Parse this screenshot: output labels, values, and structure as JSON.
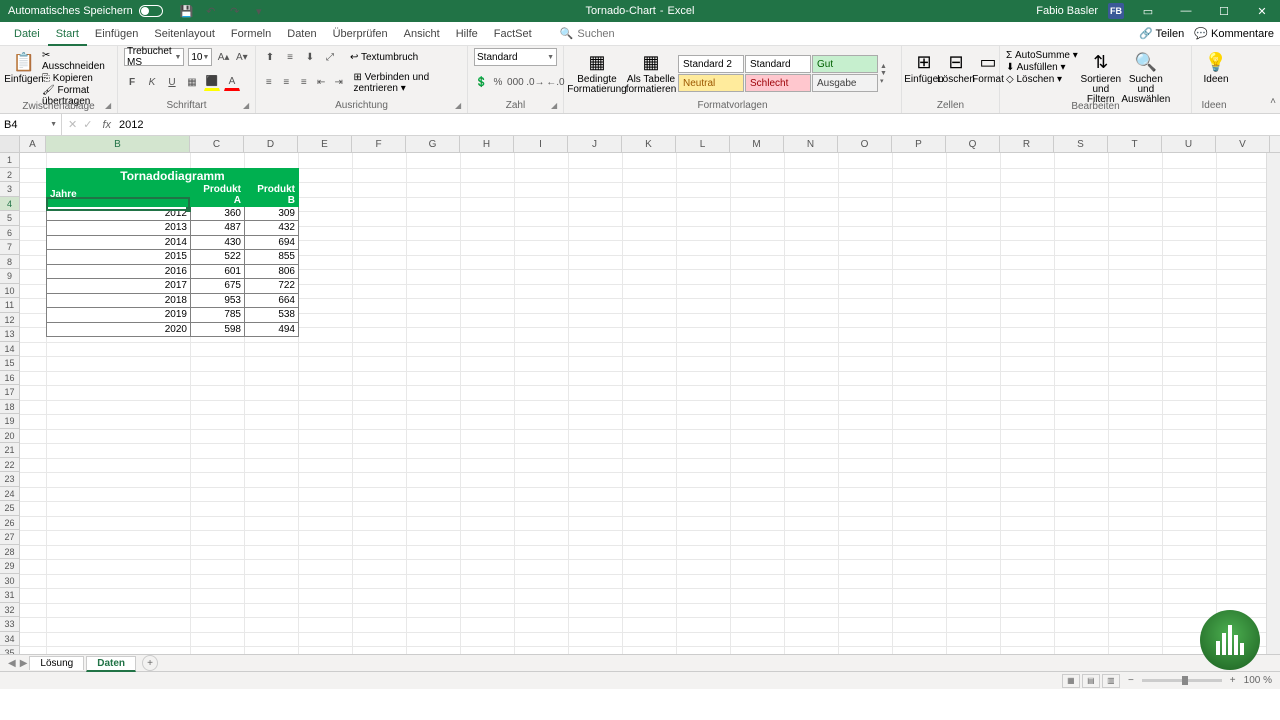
{
  "titlebar": {
    "autosave_label": "Automatisches Speichern",
    "doc_name": "Tornado-Chart",
    "app_name": "Excel",
    "user_name": "Fabio Basler",
    "user_initials": "FB"
  },
  "tabs": {
    "file": "Datei",
    "items": [
      "Start",
      "Einfügen",
      "Seitenlayout",
      "Formeln",
      "Daten",
      "Überprüfen",
      "Ansicht",
      "Hilfe",
      "FactSet"
    ],
    "active": "Start",
    "search_placeholder": "Suchen",
    "share": "Teilen",
    "comments": "Kommentare"
  },
  "ribbon": {
    "clipboard": {
      "paste": "Einfügen",
      "cut": "Ausschneiden",
      "copy": "Kopieren",
      "format_painter": "Format übertragen",
      "label": "Zwischenablage"
    },
    "font": {
      "name": "Trebuchet MS",
      "size": "10",
      "label": "Schriftart"
    },
    "align": {
      "wrap": "Textumbruch",
      "merge": "Verbinden und zentrieren",
      "label": "Ausrichtung"
    },
    "number": {
      "format": "Standard",
      "label": "Zahl"
    },
    "styles": {
      "cond": "Bedingte Formatierung",
      "table": "Als Tabelle formatieren",
      "std2": "Standard 2",
      "std": "Standard",
      "neutral": "Neutral",
      "bad": "Schlecht",
      "good": "Gut",
      "output": "Ausgabe",
      "label": "Formatvorlagen"
    },
    "cells": {
      "insert": "Einfügen",
      "delete": "Löschen",
      "format": "Format",
      "label": "Zellen"
    },
    "editing": {
      "sum": "AutoSumme",
      "fill": "Ausfüllen",
      "clear": "Löschen",
      "sort": "Sortieren und Filtern",
      "find": "Suchen und Auswählen",
      "label": "Bearbeiten"
    },
    "ideas": {
      "label": "Ideen"
    }
  },
  "formula_bar": {
    "cell_ref": "B4",
    "formula": "2012"
  },
  "grid": {
    "columns": [
      "A",
      "B",
      "C",
      "D",
      "E",
      "F",
      "G",
      "H",
      "I",
      "J",
      "K",
      "L",
      "M",
      "N",
      "O",
      "P",
      "Q",
      "R",
      "S",
      "T",
      "U",
      "V"
    ],
    "col_widths": {
      "A": 26,
      "B": 144,
      "C": 54,
      "D": 54,
      "default": 54
    },
    "row_count": 37,
    "active_cell": "B4",
    "table": {
      "title": "Tornadodiagramm",
      "headers": [
        "Jahre",
        "Produkt A",
        "Produkt B"
      ],
      "rows": [
        [
          2012,
          360,
          309
        ],
        [
          2013,
          487,
          432
        ],
        [
          2014,
          430,
          694
        ],
        [
          2015,
          522,
          855
        ],
        [
          2016,
          601,
          806
        ],
        [
          2017,
          675,
          722
        ],
        [
          2018,
          953,
          664
        ],
        [
          2019,
          785,
          538
        ],
        [
          2020,
          598,
          494
        ]
      ]
    }
  },
  "chart_data": {
    "type": "table",
    "title": "Tornadodiagramm",
    "categories": [
      2012,
      2013,
      2014,
      2015,
      2016,
      2017,
      2018,
      2019,
      2020
    ],
    "series": [
      {
        "name": "Produkt A",
        "values": [
          360,
          487,
          430,
          522,
          601,
          675,
          953,
          785,
          598
        ]
      },
      {
        "name": "Produkt B",
        "values": [
          309,
          432,
          694,
          855,
          806,
          722,
          664,
          538,
          494
        ]
      }
    ],
    "xlabel": "Jahre"
  },
  "sheets": {
    "items": [
      "Lösung",
      "Daten"
    ],
    "active": "Daten"
  },
  "status": {
    "zoom": "100 %"
  }
}
